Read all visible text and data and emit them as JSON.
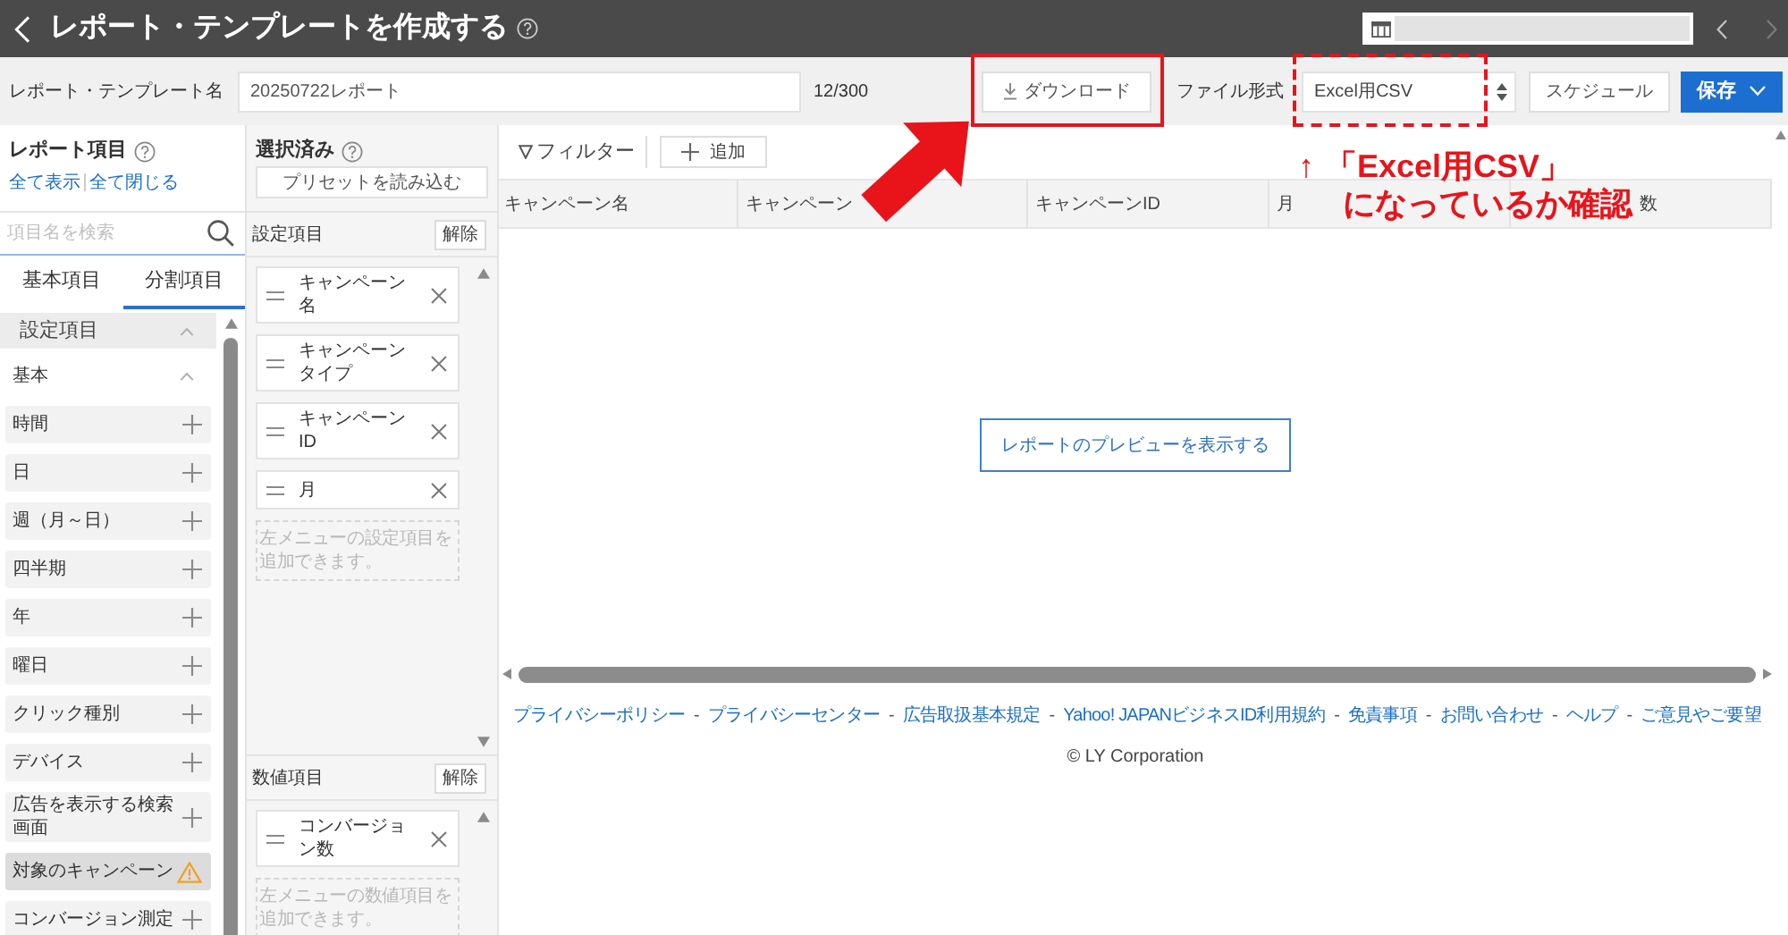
{
  "header": {
    "title": "レポート・テンプレートを作成する"
  },
  "template_bar": {
    "name_label": "レポート・テンプレート名",
    "name_value": "20250722レポート",
    "char_count": "12/300",
    "download_button": "ダウンロード",
    "format_label": "ファイル形式",
    "format_value": "Excel用CSV",
    "schedule_button": "スケジュール",
    "save_button": "保存"
  },
  "report_items": {
    "title": "レポート項目",
    "links": [
      "全て表示",
      "全て閉じる"
    ],
    "search": {
      "placeholder": "項目名を検索"
    },
    "tabs": [
      {
        "label": "基本項目",
        "selected": false
      },
      {
        "label": "分割項目",
        "selected": true
      }
    ],
    "sections": [
      {
        "label": "設定項目",
        "expanded": true,
        "children": [
          {
            "label": "基本",
            "expanded": true,
            "children": [
              {
                "label": "時間",
                "kind": "add"
              },
              {
                "label": "日",
                "kind": "add"
              },
              {
                "label": "週（月～日）",
                "kind": "add"
              },
              {
                "label": "四半期",
                "kind": "add"
              },
              {
                "label": "年",
                "kind": "add"
              },
              {
                "label": "曜日",
                "kind": "add"
              },
              {
                "label": "クリック種別",
                "kind": "add"
              },
              {
                "label": "デバイス",
                "kind": "add"
              },
              {
                "label": "広告を表示する検索画面",
                "kind": "add"
              },
              {
                "label": "対象のキャンペーン",
                "kind": "warning"
              },
              {
                "label": "コンバージョン測定",
                "kind": "add"
              }
            ]
          }
        ]
      }
    ]
  },
  "selected_panel": {
    "title": "選択済み",
    "preset_button": "プリセットを読み込む",
    "groups": [
      {
        "title": "設定項目",
        "clear_button": "解除",
        "items": [
          "キャンペーン名",
          "キャンペーンタイプ",
          "キャンペーンID",
          "月"
        ],
        "hint": "左メニューの設定項目を追加できます。"
      },
      {
        "title": "数値項目",
        "clear_button": "解除",
        "items": [
          "コンバージョン数"
        ],
        "hint": "左メニューの数値項目を追加できます。"
      }
    ]
  },
  "report_area": {
    "filter_button": "フィルター",
    "add_button": "追加",
    "table": {
      "columns": [
        "キャンペーン名",
        "キャンペーン",
        "キャンペーンID",
        "月",
        "数"
      ]
    },
    "preview_button": "レポートのプレビューを表示する"
  },
  "footer": {
    "items": [
      {
        "kind": "link",
        "text": "プライバシーポリシー"
      },
      {
        "kind": "separator",
        "text": "-"
      },
      {
        "kind": "link",
        "text": "プライバシーセンター"
      },
      {
        "kind": "separator",
        "text": "-"
      },
      {
        "kind": "link",
        "text": "広告取扱基本規定"
      },
      {
        "kind": "separator",
        "text": "-"
      },
      {
        "kind": "link",
        "text": "Yahoo! JAPANビジネスID利用規約"
      },
      {
        "kind": "separator",
        "text": "-"
      },
      {
        "kind": "link",
        "text": "免責事項"
      },
      {
        "kind": "separator",
        "text": "-"
      },
      {
        "kind": "link",
        "text": "お問い合わせ"
      },
      {
        "kind": "separator",
        "text": "-"
      },
      {
        "kind": "link",
        "text": "ヘルプ"
      },
      {
        "kind": "separator",
        "text": "-"
      },
      {
        "kind": "link",
        "text": "ご意見やご要望"
      }
    ],
    "copyright": "© LY Corporation"
  },
  "annotation": {
    "arrow": "↑",
    "lines": [
      "「Excel用CSV」",
      "になっているか確認"
    ]
  }
}
